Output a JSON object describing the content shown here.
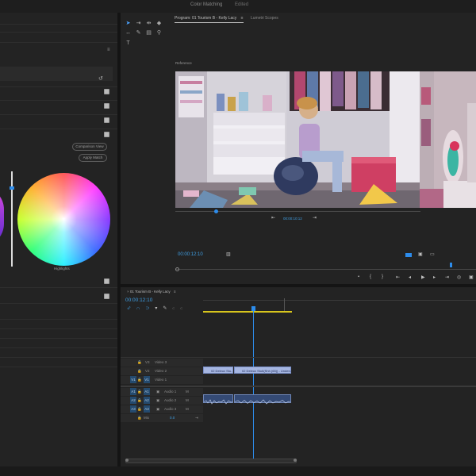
{
  "window": {
    "title": "Color Matching",
    "subtitle": "Edited"
  },
  "program_monitor": {
    "tabs": [
      "Program: 01 Tourism B - Kelly Lacy",
      "Lumetri Scopes"
    ],
    "tab_menu_icon": "≡",
    "reference_label": "Reference",
    "ref_timecode": "00:00:10:12",
    "timecode": "00:00:12:10"
  },
  "color_match": {
    "comparison_view_label": "Comparison View",
    "apply_match_label": "Apply Match",
    "highlights_label": "Highlights"
  },
  "timeline": {
    "tab": "01 Tourism B - Kelly Lacy",
    "tab_menu_icon": "≡",
    "timecode": "00:00:12:10",
    "video_tracks": [
      {
        "name": "V3",
        "label": "Video 3"
      },
      {
        "name": "V2",
        "label": "Video 2"
      },
      {
        "name": "V1",
        "label": "Video 1"
      }
    ],
    "audio_tracks": [
      {
        "name": "A1",
        "label": "Audio 1",
        "toggle": "M"
      },
      {
        "name": "A2",
        "label": "Audio 2",
        "toggle": "M"
      },
      {
        "name": "A3",
        "label": "Audio 3",
        "toggle": "M"
      }
    ],
    "mix_label": "Mix",
    "mix_value": "0.0",
    "clips": [
      {
        "label": "02 Deleux Stu..."
      },
      {
        "label": "02 Deleux Stu6(Shh (65)) - Underwatch"
      }
    ]
  },
  "colors": {
    "accent": "#2d8ceb",
    "timecode": "#3f9fe5",
    "clip_video": "#a6b6e1",
    "clip_audio": "#344a75",
    "work_area": "#d7c51d"
  },
  "icons": [
    "selection-tool-icon",
    "track-select-icon",
    "ripple-edit-icon",
    "razor-tool-icon",
    "slip-tool-icon",
    "pen-tool-icon",
    "hand-tool-icon",
    "zoom-tool-icon",
    "type-tool-icon",
    "play-icon",
    "step-back-icon",
    "step-forward-icon",
    "marker-icon",
    "camera-icon",
    "settings-icon"
  ]
}
